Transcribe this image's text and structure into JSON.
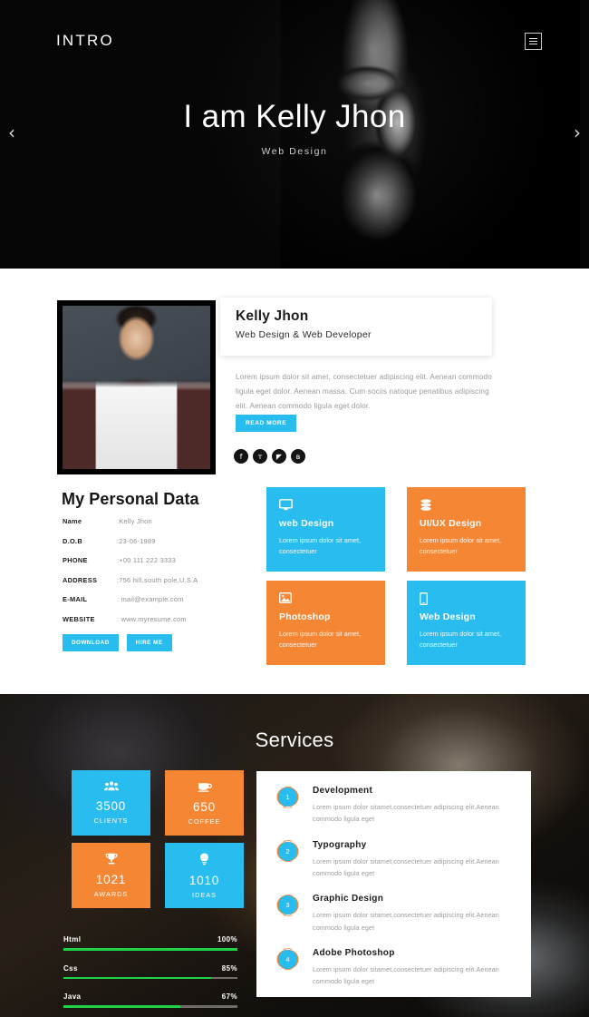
{
  "hero": {
    "brand": "INTRO",
    "menu_icon": "hamburger-icon",
    "title": "I am Kelly Jhon",
    "subtitle": "Web Design",
    "prev_arrow": "‹",
    "next_arrow": "›"
  },
  "about": {
    "name": "Kelly Jhon",
    "role": "Web Design & Web Developer",
    "bio": "Lorem ipsum dolor sit amet, consectetuer adipiscing elit. Aenean commodo ligula eget dolor. Aenean massa. Cum sociis natoque penatibus adipiscing elit. Aenean commodo ligula eget dolor.",
    "read_more_label": "READ MORE",
    "social": [
      {
        "name": "facebook-icon",
        "glyph": "f"
      },
      {
        "name": "twitter-icon",
        "glyph": "ᴛ"
      },
      {
        "name": "rss-icon",
        "glyph": "◤"
      },
      {
        "name": "vk-icon",
        "glyph": "в"
      }
    ]
  },
  "personal_data": {
    "title": "My Personal Data",
    "rows": [
      {
        "label": "Name",
        "value": ":Kelly Jhon"
      },
      {
        "label": "D.O.B",
        "value": ":23-06-1989"
      },
      {
        "label": "PHONE",
        "value": ":+00 111 222 3333"
      },
      {
        "label": "ADDRESS",
        "value": ":756 hill,south pole,U.S.A"
      },
      {
        "label": "E-MAIL",
        "value": ": mail@example.com"
      },
      {
        "label": "WEBSITE",
        "value": ": www.myresume.com"
      }
    ],
    "download_label": "DOWNLOAD",
    "hire_label": "HIRE ME"
  },
  "service_cards": [
    {
      "title": "web Design",
      "desc": "Lorem ipsum dolor sit amet, consectetuer",
      "color": "cyan",
      "icon": "monitor-icon",
      "glyph": "▢"
    },
    {
      "title": "UI/UX Design",
      "desc": "Lorem ipsum dolor sit amet, consectetuer",
      "color": "orange",
      "icon": "database-icon",
      "glyph": "≣"
    },
    {
      "title": "Photoshop",
      "desc": "Lorem ipsum dolor sit amet, consectetuer",
      "color": "orange",
      "icon": "image-icon",
      "glyph": "▣"
    },
    {
      "title": "Web Design",
      "desc": "Lorem ipsum dolor sit amet, consectetuer",
      "color": "cyan",
      "icon": "mobile-icon",
      "glyph": "▯"
    }
  ],
  "services": {
    "title": "Services",
    "stats": [
      {
        "value": "3500",
        "label": "CLIENTS",
        "color": "cyan",
        "icon": "users-icon",
        "glyph": "♟"
      },
      {
        "value": "650",
        "label": "COFFEE",
        "color": "orange",
        "icon": "coffee-cup-icon",
        "glyph": "☕"
      },
      {
        "value": "1021",
        "label": "AWARDS",
        "color": "orange",
        "icon": "trophy-icon",
        "glyph": "♛"
      },
      {
        "value": "1010",
        "label": "IDEAS",
        "color": "cyan",
        "icon": "lightbulb-icon",
        "glyph": "⚲"
      }
    ],
    "skills": [
      {
        "name": "Html",
        "percent": "100%",
        "value": 100
      },
      {
        "name": "Css",
        "percent": "85%",
        "value": 85
      },
      {
        "name": "Java",
        "percent": "67%",
        "value": 67
      }
    ],
    "list": [
      {
        "num": "1",
        "title": "Development",
        "desc": "Lorem ipsum dolor sitamet,consectetuer adipiscing elit.Aenean commodo ligula eget"
      },
      {
        "num": "2",
        "title": "Typography",
        "desc": "Lorem ipsum dolor sitamet,consectetuer adipiscing elit.Aenean commodo ligula eget"
      },
      {
        "num": "3",
        "title": "Graphic Design",
        "desc": "Lorem ipsum dolor sitamet,consectetuer adipiscing elit.Aenean commodo ligula eget"
      },
      {
        "num": "4",
        "title": "Adobe Photoshop",
        "desc": "Lorem ipsum dolor sitamet,consectetuer adipiscing elit.Aenean commodo ligula eget"
      }
    ]
  },
  "colors": {
    "cyan": "#29bcee",
    "orange": "#f58634",
    "green": "#1fd348",
    "dark": "#050505"
  }
}
